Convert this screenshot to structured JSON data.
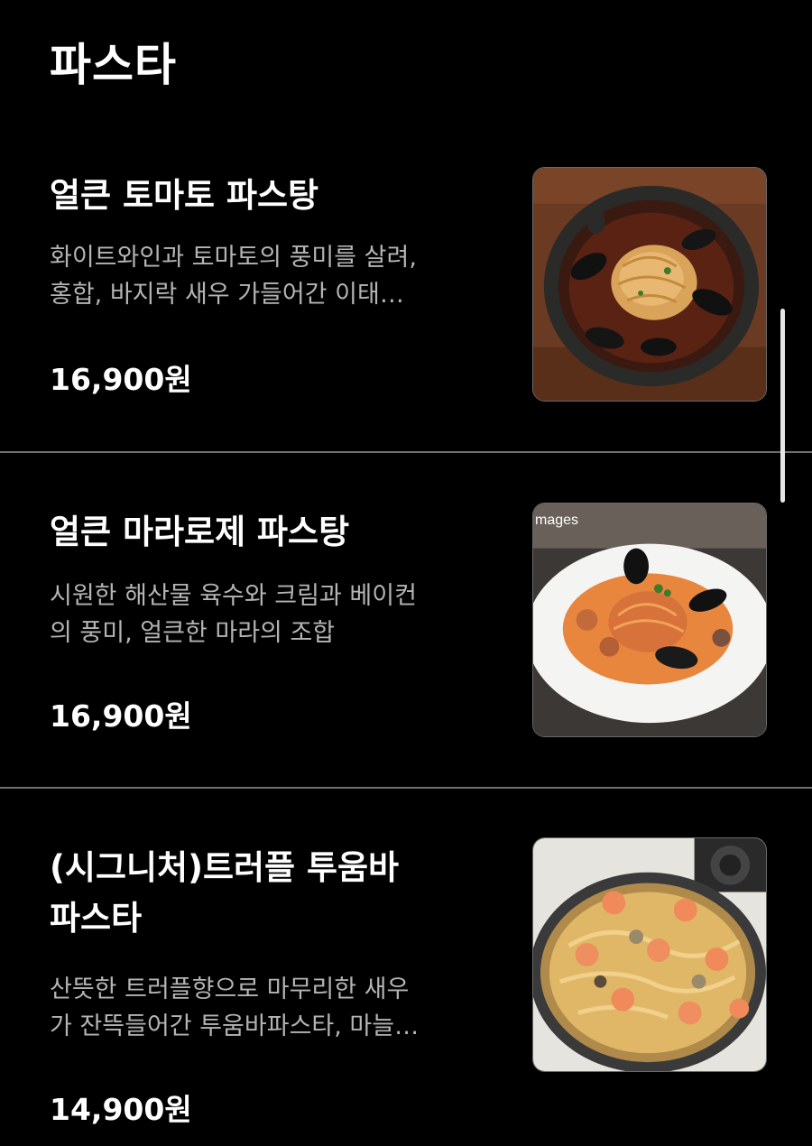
{
  "section": {
    "title": "파스타"
  },
  "items": [
    {
      "name": "얼큰 토마토 파스탕",
      "description": "화이트와인과 토마토의 풍미를 살려,\n홍합, 바지락 새우 가들어간 이태…",
      "price": "16,900원",
      "image_icon": "tomato-pasta-stew-photo"
    },
    {
      "name": "얼큰 마라로제 파스탕",
      "description": "시원한 해산물 육수와 크림과 베이컨\n의 풍미, 얼큰한 마라의 조합",
      "price": "16,900원",
      "image_icon": "mala-rose-pasta-photo",
      "image_watermark": "mages"
    },
    {
      "name": "(시그니처)트러플 투움바\n파스타",
      "description": "산뜻한 트러플향으로 마무리한 새우\n가 잔뜩들어간 투움바파스타, 마늘…",
      "price": "14,900원",
      "image_icon": "truffle-toowoomba-pasta-photo"
    }
  ],
  "colors": {
    "background": "#000000",
    "text_primary": "#ffffff",
    "text_secondary": "#b4b4b4",
    "divider": "#6f6f6f"
  }
}
